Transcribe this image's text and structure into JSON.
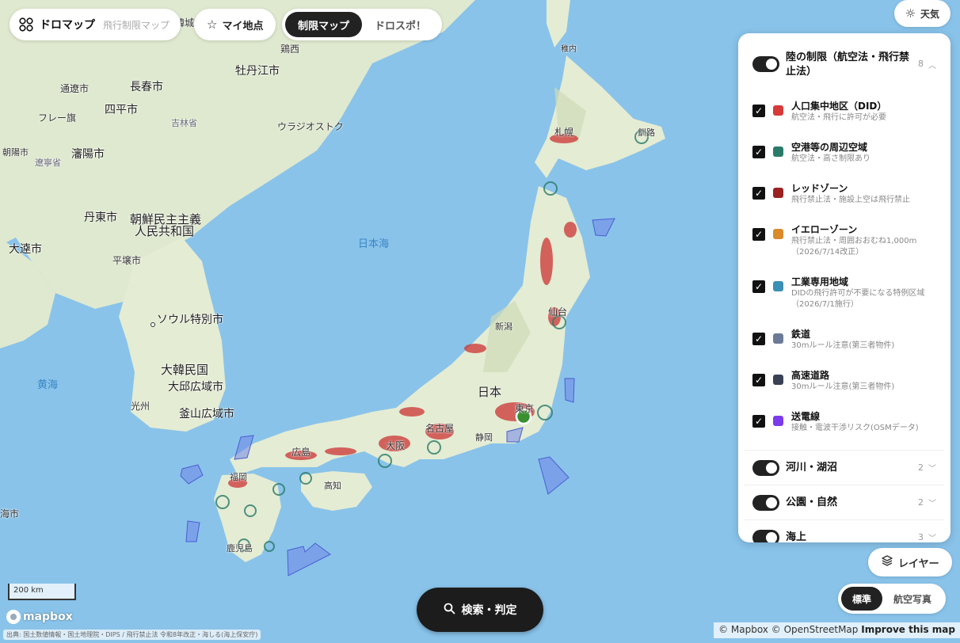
{
  "header": {
    "brand_title": "ドロマップ",
    "brand_subtitle": "飛行制限マップ",
    "my_points_label": "マイ地点",
    "tabs": [
      {
        "label": "制限マップ",
        "active": true
      },
      {
        "label": "ドロスポ！",
        "active": false
      }
    ],
    "weather_label": "天気"
  },
  "map": {
    "labels": {
      "hancheng": "韓城市",
      "jixi": "鶏西",
      "wakkanai": "稚内",
      "mudanjiang": "牡丹江市",
      "tonghua": "通遼市",
      "changchun": "長春市",
      "siping": "四平市",
      "jilin": "吉林省",
      "fuxin": "フレー旗",
      "vladivostok": "ウラジオストク",
      "sapporo": "札幌",
      "kushiro": "釧路",
      "chaoyang": "朝陽市",
      "yanji": "瀋陽市",
      "liaoning": "遼寧省",
      "dandong": "丹東市",
      "dprk_1": "朝鮮民主主義",
      "dprk_2": "人民共和国",
      "dalian": "大連市",
      "pyongyang": "平壌市",
      "sea_of_japan": "日本海",
      "sendai": "仙台",
      "niigata": "新潟",
      "seoul": "ソウル特別市",
      "korea": "大韓民国",
      "daejeon": "大邱広域市",
      "yellow_sea": "黄海",
      "gwangju": "光州",
      "busan": "釜山広域市",
      "japan": "日本",
      "tokyo": "東京",
      "nagoya": "名古屋",
      "osaka": "大阪",
      "shizuoka": "静岡",
      "hiroshima": "広島",
      "fukuoka": "福岡",
      "kochi": "高知",
      "kagoshima": "鹿児島",
      "shanghai": "海市"
    }
  },
  "panel": {
    "land_group": {
      "label": "陸の制限（航空法・飛行禁止法）",
      "count": "8",
      "expanded": true
    },
    "items": [
      {
        "name": "人口集中地区（DID）",
        "desc": "航空法・飛行に許可が必要",
        "color": "#d63a3a",
        "checked": true
      },
      {
        "name": "空港等の周辺空域",
        "desc": "航空法・高さ制限あり",
        "color": "#2a7a6a",
        "checked": true
      },
      {
        "name": "レッドゾーン",
        "desc": "飛行禁止法・施設上空は飛行禁止",
        "color": "#9b2222",
        "checked": true
      },
      {
        "name": "イエローゾーン",
        "desc": "飛行禁止法・周囲おおむね1,000m",
        "desc2": "（2026/7/14改正）",
        "color": "#d98a2b",
        "checked": true
      },
      {
        "name": "工業専用地域",
        "desc": "DIDの飛行許可が不要になる特例区域",
        "desc2": "（2026/7/1施行）",
        "color": "#3a8fb5",
        "checked": true
      },
      {
        "name": "鉄道",
        "desc": "30mルール注意(第三者物件)",
        "color": "#6b7a96",
        "checked": true
      },
      {
        "name": "高速道路",
        "desc": "30mルール注意(第三者物件)",
        "color": "#3a4156",
        "checked": true
      },
      {
        "name": "送電線",
        "desc": "接触・電波干渉リスク(OSMデータ)",
        "color": "#7c3aed",
        "checked": true
      }
    ],
    "groups": [
      {
        "label": "河川・湖沼",
        "count": "2"
      },
      {
        "label": "公園・自然",
        "count": "2"
      },
      {
        "label": "海上",
        "count": "3"
      }
    ]
  },
  "controls": {
    "layer_button": "レイヤー",
    "basemap_options": [
      {
        "label": "標準",
        "active": true
      },
      {
        "label": "航空写真",
        "active": false
      }
    ],
    "search_button": "検索・判定"
  },
  "footer": {
    "scale": "200 km",
    "mapbox": "mapbox",
    "source": "出典: 国土数値情報・国土地理院・DIPS / 飛行禁止法 令和8年改正・海しる(海上保安庁)",
    "attribution_1": "© Mapbox",
    "attribution_2": "© OpenStreetMap",
    "attribution_3": "Improve this map"
  }
}
